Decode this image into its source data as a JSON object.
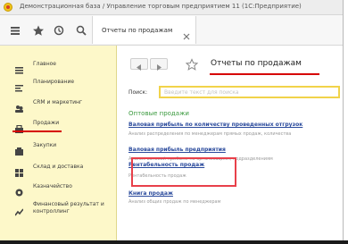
{
  "window": {
    "title": "Демонстрационная база / Управление торговым предприятием 11 (1С:Предприятие)"
  },
  "toolbar": {
    "icons": [
      "menu-icon",
      "star-icon",
      "history-icon",
      "search-icon"
    ],
    "tab_label": "Отчеты по продажам"
  },
  "sidebar": {
    "items": [
      {
        "label": "Главное",
        "icon": "home-icon"
      },
      {
        "label": "Планирование",
        "icon": "planning-icon"
      },
      {
        "label": "CRM и маркетинг",
        "icon": "crm-icon"
      },
      {
        "label": "Продажи",
        "icon": "sales-icon"
      },
      {
        "label": "Закупки",
        "icon": "purchases-icon"
      },
      {
        "label": "Склад и доставка",
        "icon": "warehouse-icon"
      },
      {
        "label": "Казначейство",
        "icon": "treasury-icon"
      },
      {
        "label": "Финансовый результат и контроллинг",
        "icon": "finance-icon"
      }
    ]
  },
  "content": {
    "title": "Отчеты по продажам",
    "search": {
      "label": "Поиск:",
      "placeholder": "Введите текст для поиска"
    },
    "groups": [
      {
        "heading": "Оптовые продажи",
        "reports": [
          {
            "link": "Валовая прибыль по количеству проведенных отгрузок",
            "description": "Анализ распределения по менеджерам прямых продаж, количества"
          },
          {
            "link": "Валовая прибыль предприятия",
            "description": "Анализ валовой прибыли по организациям, подразделениям"
          },
          {
            "link": "Рентабельность продаж",
            "description": "Рентабельность продаж"
          },
          {
            "link": "Книга продаж",
            "description": "Анализ общих продаж по менеджерам"
          }
        ]
      }
    ]
  },
  "colors": {
    "sidebar_bg": "#fdf8c9",
    "accent_red": "#d60000",
    "link_blue": "#2a4a9c",
    "group_green": "#3b9a3f",
    "search_border": "#f1d34a"
  }
}
